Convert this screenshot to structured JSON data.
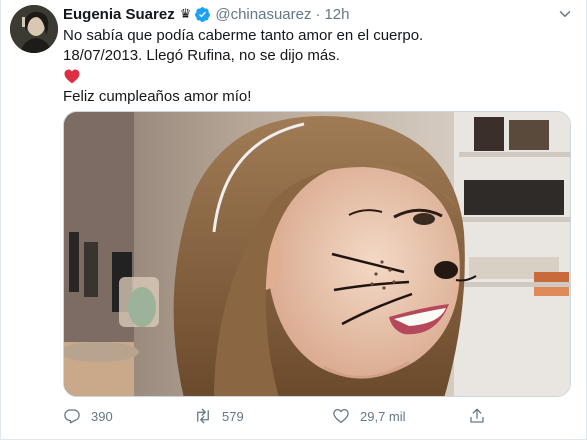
{
  "tweet": {
    "author": {
      "display_name": "Eugenia Suarez",
      "badge_icon": "crown-icon",
      "verified": true,
      "handle": "@chinasuarez",
      "separator": "·",
      "time": "12h"
    },
    "text_lines": [
      "No sabía que podía caberme tanto amor en el cuerpo.",
      "18/07/2013. Llegó Rufina, no se dijo más."
    ],
    "emoji": "red-heart-icon",
    "closing_line": "Feliz cumpleaños amor mío!",
    "media": {
      "type": "photo",
      "subject_icon": "photo-girl-cat-face-paint"
    },
    "actions": {
      "replies": "390",
      "retweets": "579",
      "likes": "29,7 mil"
    }
  },
  "colors": {
    "text": "#14171a",
    "secondary_text": "#657786",
    "verified_blue": "#1da1f2",
    "heart_red": "#dd2e44",
    "border": "#e1e8ed"
  }
}
